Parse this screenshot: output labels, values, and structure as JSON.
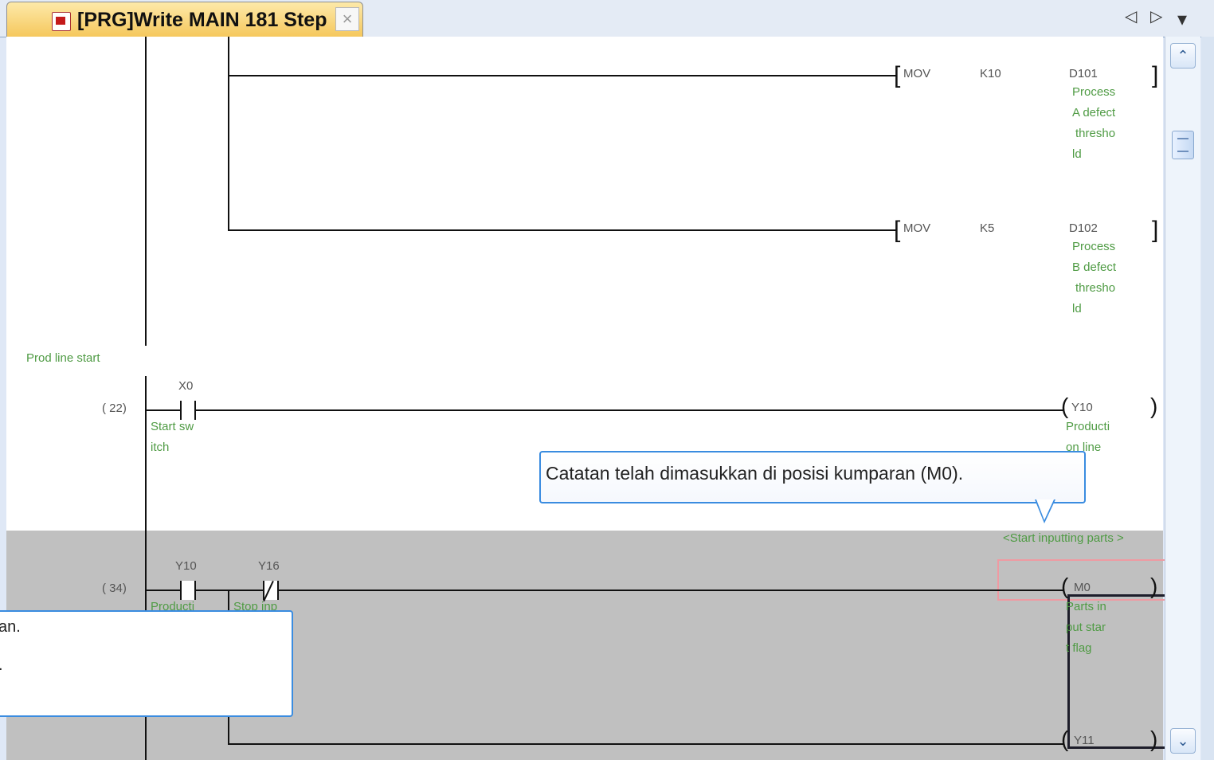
{
  "tab": {
    "title": "[PRG]Write MAIN 181 Step",
    "close": "×"
  },
  "nav": {
    "prev": "◁",
    "next": "▷",
    "menu": "▾"
  },
  "ladder": {
    "rows": [
      {
        "instr": "MOV",
        "operand1": "K10",
        "device": "D101",
        "comment": [
          "Process",
          "A defect",
          "thresho",
          "ld"
        ]
      },
      {
        "instr": "MOV",
        "operand1": "K5",
        "device": "D102",
        "comment": [
          "Process",
          "B defect",
          "thresho",
          "ld"
        ]
      }
    ],
    "statement": "Prod line start",
    "step22": "( 22)",
    "x0": "X0",
    "x0_comment": [
      "Start sw",
      "itch"
    ],
    "y10": "Y10",
    "y10_comment": [
      "Producti",
      "on line"
    ],
    "note": "<Start inputting parts >",
    "step34": "( 34)",
    "contact_y10": "Y10",
    "contact_y16": "Y16",
    "contact_y10_comment": "Producti",
    "contact_y16_comment": "Stop inp",
    "m0": "M0",
    "m0_comment": [
      "Parts in",
      "put star",
      "t flag"
    ],
    "y11": "Y11"
  },
  "tooltip": {
    "text": "Catatan telah dimasukkan di posisi kumparan (M0)."
  },
  "popup": {
    "line1": "an.",
    "line2": "."
  }
}
